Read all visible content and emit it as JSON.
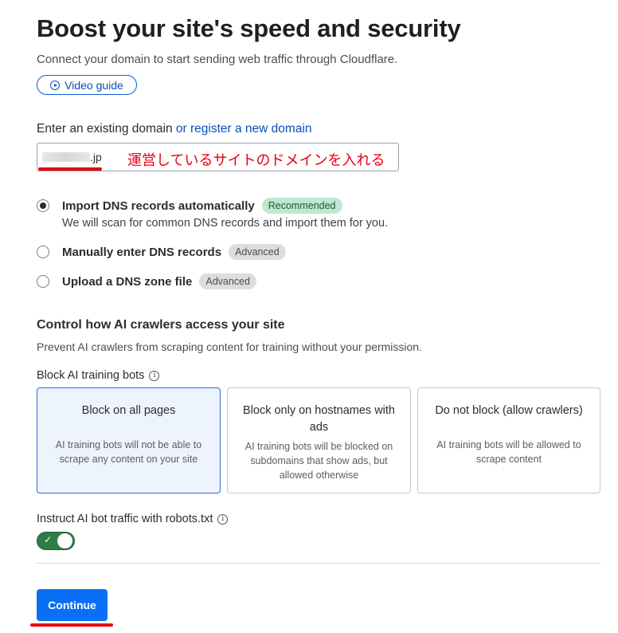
{
  "page": {
    "title": "Boost your site's speed and security",
    "subtitle": "Connect your domain to start sending web traffic through Cloudflare.",
    "video_guide_label": "Video guide"
  },
  "domain": {
    "label_prefix": "Enter an existing domain",
    "register_link": "or register a new domain",
    "value_suffix": ".jp",
    "annotation": "運営しているサイトのドメインを入れる"
  },
  "dns_options": [
    {
      "label": "Import DNS records automatically",
      "badge": "Recommended",
      "desc": "We will scan for common DNS records and import them for you.",
      "checked": true
    },
    {
      "label": "Manually enter DNS records",
      "badge": "Advanced",
      "checked": false
    },
    {
      "label": "Upload a DNS zone file",
      "badge": "Advanced",
      "checked": false
    }
  ],
  "ai": {
    "title": "Control how AI crawlers access your site",
    "desc": "Prevent AI crawlers from scraping content for training without your permission.",
    "block_label": "Block AI training bots",
    "cards": [
      {
        "title": "Block on all pages",
        "desc": "AI training bots will not be able to scrape any content on your site"
      },
      {
        "title": "Block only on hostnames with ads",
        "desc": "AI training bots will be blocked on subdomains that show ads, but allowed otherwise"
      },
      {
        "title": "Do not block (allow crawlers)",
        "desc": "AI training bots will be allowed to scrape content"
      }
    ],
    "robots_label": "Instruct AI bot traffic with robots.txt",
    "robots_enabled": true
  },
  "actions": {
    "continue_label": "Continue"
  },
  "icons": {
    "info": "ⓘ",
    "check": "✓"
  },
  "colors": {
    "accent": "#0b6ff5",
    "annotation": "#e60012",
    "toggle_on": "#2e7d46"
  }
}
